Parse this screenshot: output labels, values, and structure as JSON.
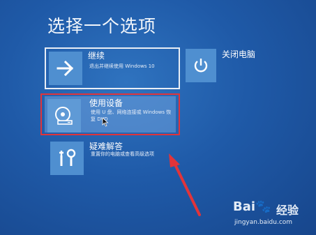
{
  "screen_title": "选择一个选项",
  "options": {
    "continue": {
      "title": "继续",
      "description": "退出并继续使用 Windows 10",
      "icon": "arrow-right-icon"
    },
    "use_device": {
      "title": "使用设备",
      "description": "使用 U 盘、网络连接或 Windows 恢复 DVD",
      "icon": "disc-drive-icon"
    },
    "troubleshoot": {
      "title": "疑难解答",
      "description": "重置你的电脑或查看高级选项",
      "icon": "tools-icon"
    },
    "shutdown": {
      "title": "关闭电脑",
      "icon": "power-icon"
    }
  },
  "annotation": {
    "highlight_color": "#e1343a",
    "arrow_color": "#e1343a"
  },
  "watermark": {
    "logo": "Bai",
    "paw": "du",
    "site_name": "经验",
    "url": "jingyan.baidu.com"
  },
  "colors": {
    "background": "#1f5aa8",
    "tile": "#4f8fd0"
  }
}
